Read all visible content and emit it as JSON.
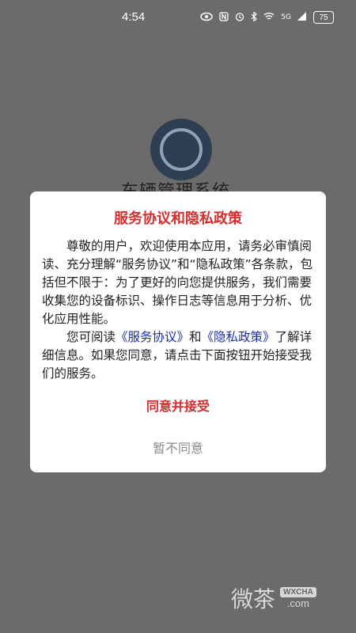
{
  "status_bar": {
    "time": "4:54",
    "icons": [
      "eye-icon",
      "nfc-icon",
      "alarm-icon",
      "bluetooth-icon",
      "wifi-icon",
      "signal-icon"
    ],
    "signal_label": "5G",
    "battery": "75"
  },
  "app": {
    "title": "车辆管理系统"
  },
  "dialog": {
    "title": "服务协议和隐私政策",
    "p1": "尊敬的用户，欢迎使用本应用，请务必审慎阅读、充分理解“服务协议”和“隐私政策”各条款，包括但不限于：为了更好的向您提供服务，我们需要收集您的设备标识、操作日志等信息用于分析、优化应用性能。",
    "p2_prefix": "您可阅读",
    "link_service": "《服务协议》",
    "p2_and": "和",
    "link_privacy": "《隐私政策》",
    "p2_suffix": "了解详细信息。如果您同意，请点击下面按钮开始接受我们的服务。",
    "agree_label": "同意并接受",
    "disagree_label": "暂不同意"
  },
  "watermark": {
    "text_cn": "微茶",
    "badge": "WXCHA",
    "domain": ".com"
  }
}
